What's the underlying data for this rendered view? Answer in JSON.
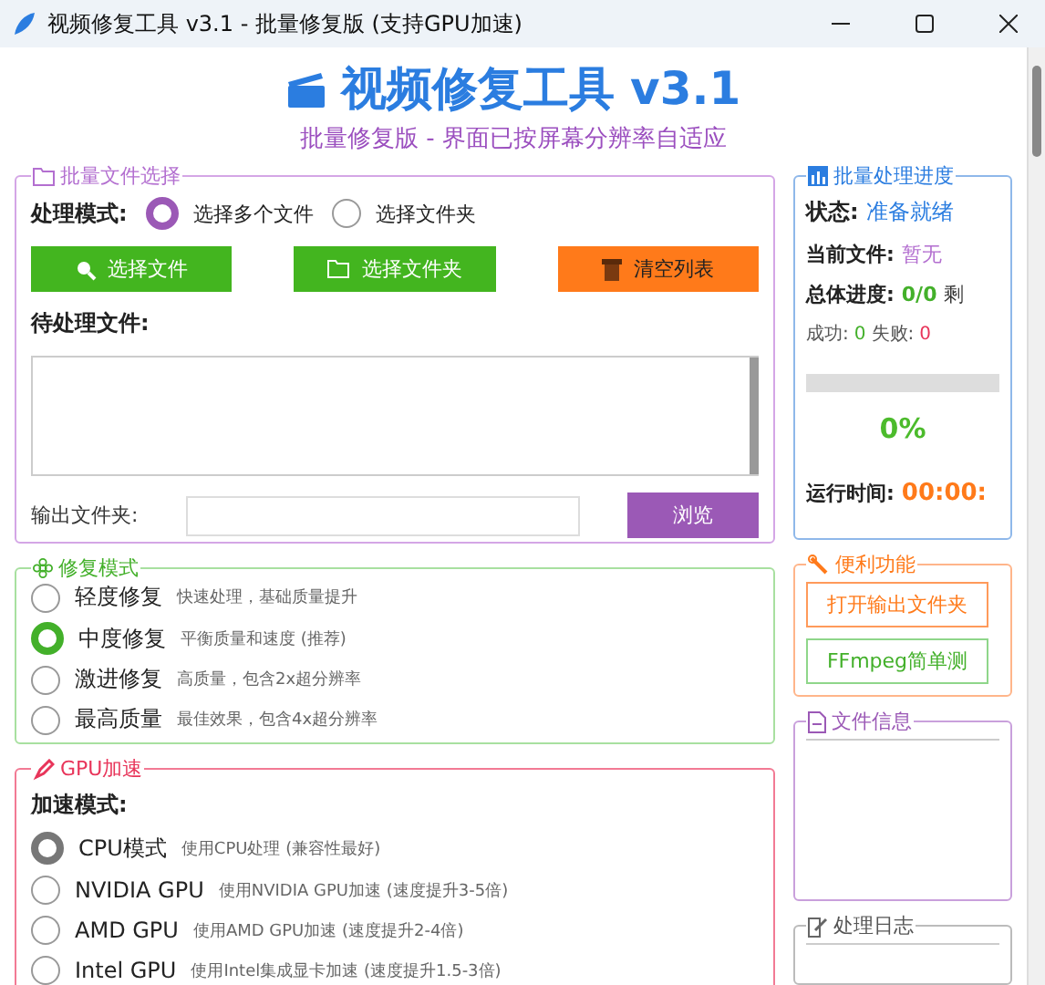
{
  "window": {
    "title": "视频修复工具 v3.1 - 批量修复版 (支持GPU加速)"
  },
  "header": {
    "title": "视频修复工具 v3.1",
    "subtitle": "批量修复版 - 界面已按屏幕分辨率自适应"
  },
  "file_selection": {
    "legend": "批量文件选择",
    "mode_label": "处理模式:",
    "modes": [
      {
        "label": "选择多个文件",
        "selected": true
      },
      {
        "label": "选择文件夹",
        "selected": false
      }
    ],
    "buttons": [
      {
        "label": "选择文件",
        "kind": "files"
      },
      {
        "label": "选择文件夹",
        "kind": "folder"
      },
      {
        "label": "清空列表",
        "kind": "clear"
      }
    ],
    "pending_label": "待处理文件:",
    "output_label": "输出文件夹:",
    "browse": "浏览"
  },
  "repair_mode": {
    "legend": "修复模式",
    "options": [
      {
        "label": "轻度修复",
        "description": "快速处理，基础质量提升",
        "selected": false
      },
      {
        "label": "中度修复",
        "description": "平衡质量和速度 (推荐)",
        "selected": true
      },
      {
        "label": "激进修复",
        "description": "高质量，包含2x超分辨率",
        "selected": false
      },
      {
        "label": "最高质量",
        "description": "最佳效果，包含4x超分辨率",
        "selected": false
      }
    ]
  },
  "gpu": {
    "legend": "GPU加速",
    "mode_label": "加速模式:",
    "options": [
      {
        "label": "CPU模式",
        "description": "使用CPU处理 (兼容性最好)",
        "selected": true
      },
      {
        "label": "NVIDIA GPU",
        "description": "使用NVIDIA GPU加速 (速度提升3-5倍)",
        "selected": false
      },
      {
        "label": "AMD GPU",
        "description": "使用AMD GPU加速 (速度提升2-4倍)",
        "selected": false
      },
      {
        "label": "Intel GPU",
        "description": "使用Intel集成显卡加速 (速度提升1.5-3倍)",
        "selected": false
      }
    ]
  },
  "progress": {
    "legend": "批量处理进度",
    "status_label": "状态:",
    "status": "准备就绪",
    "current_label": "当前文件:",
    "current": "暂无",
    "total_label": "总体进度:",
    "total": "0/0",
    "remaining_label": "剩",
    "success_label": "成功:",
    "success": "0",
    "failed_label": "失败:",
    "failed": "0",
    "level": 0,
    "percent": "0%",
    "runtime_label": "运行时间:",
    "runtime": "00:00:"
  },
  "tools": {
    "legend": "便利功能",
    "buttons": [
      {
        "label": "打开输出文件夹",
        "kind": "orange"
      },
      {
        "label": "FFmpeg简单测",
        "kind": "green"
      }
    ]
  },
  "file_info": {
    "legend": "文件信息"
  },
  "log": {
    "legend": "处理日志"
  }
}
